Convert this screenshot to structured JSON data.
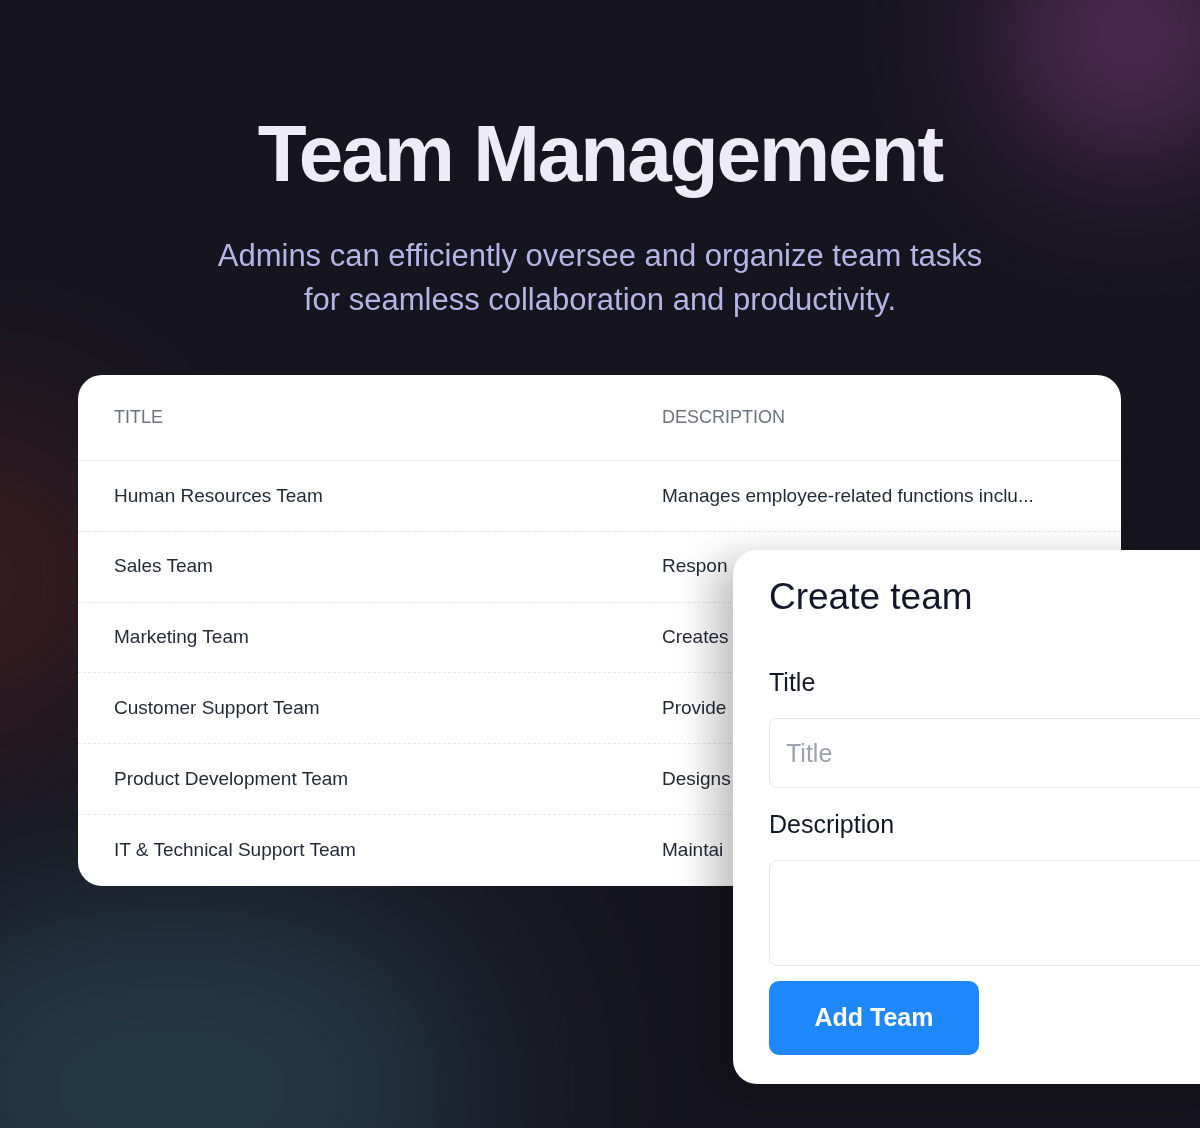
{
  "heading": "Team Management",
  "subtitle_lines": [
    "Admins can efficiently oversee and organize team tasks",
    "for seamless collaboration and productivity."
  ],
  "table": {
    "columns": [
      "TITLE",
      "DESCRIPTION"
    ],
    "rows": [
      {
        "title": "Human Resources Team",
        "description": "Manages employee-related functions inclu..."
      },
      {
        "title": "Sales Team",
        "description": "Respon"
      },
      {
        "title": "Marketing Team",
        "description": "Creates"
      },
      {
        "title": "Customer Support Team",
        "description": "Provide"
      },
      {
        "title": "Product Development Team",
        "description": "Designs"
      },
      {
        "title": "IT & Technical Support Team",
        "description": "Maintai"
      }
    ]
  },
  "dialog": {
    "title": "Create team",
    "fields": [
      {
        "kind": "input",
        "label": "Title",
        "placeholder": "Title"
      },
      {
        "kind": "textarea",
        "label": "Description"
      }
    ],
    "button": "Add Team"
  }
}
